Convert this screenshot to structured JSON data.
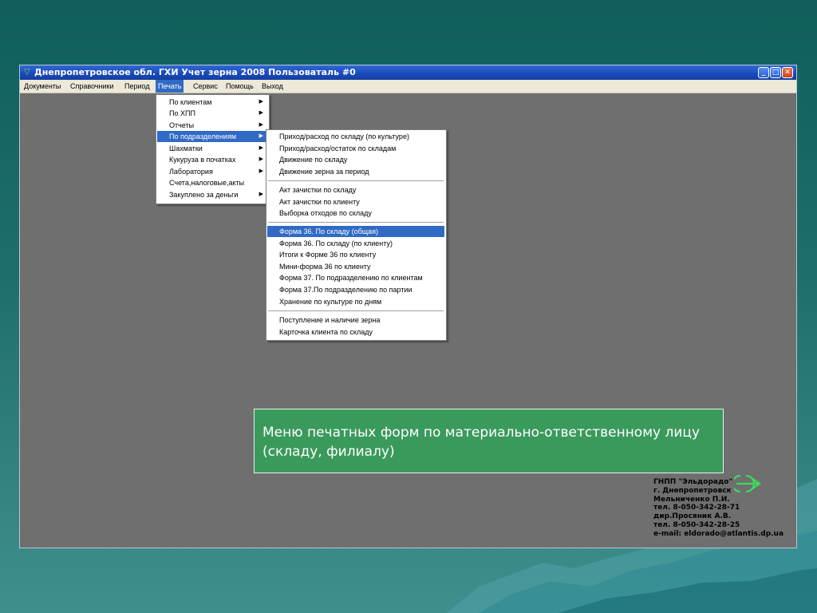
{
  "window": {
    "title": "Днепропетровское  обл. ГХИ Учет зерна 2008 Пользоваталь #0",
    "controls": [
      "minimize",
      "maximize",
      "close"
    ]
  },
  "menubar": {
    "items": [
      {
        "label": "Документы"
      },
      {
        "label": "Справочники"
      },
      {
        "label": "Период"
      },
      {
        "label": "Печать",
        "active": true
      },
      {
        "label": "Сервис"
      },
      {
        "label": "Помощь"
      },
      {
        "label": "Выход"
      }
    ]
  },
  "print_menu": {
    "items": [
      {
        "label": "По клиентам",
        "submenu": true
      },
      {
        "label": "По ХПП",
        "submenu": true
      },
      {
        "label": "Отчеты",
        "submenu": true
      },
      {
        "label": "По подразделениям",
        "submenu": true,
        "highlighted": true
      },
      {
        "label": "Шахматки",
        "submenu": true
      },
      {
        "label": "Кукуруза в початках",
        "submenu": true
      },
      {
        "label": "Лаборатория",
        "submenu": true
      },
      {
        "label": "Счета,налоговые,акты",
        "submenu": false
      },
      {
        "label": "Закуплено за деньги",
        "submenu": true
      }
    ]
  },
  "subdivision_menu": {
    "items": [
      {
        "label": "Приход/расход по складу (по культуре)"
      },
      {
        "label": "Приход/расход/остаток по складам"
      },
      {
        "label": "Движение по складу"
      },
      {
        "label": "Движение зерна за период"
      },
      {
        "label": "Акт зачистки по складу"
      },
      {
        "label": "Акт зачистки по клиенту"
      },
      {
        "label": "Выборка отходов по складу"
      },
      {
        "label": "Форма 36. По складу (общая)",
        "highlighted": true
      },
      {
        "label": "Форма 36. По складу (по клиенту)"
      },
      {
        "label": "Итоги к Форме 36 по клиенту"
      },
      {
        "label": "Мини-форма 36 по клиенту"
      },
      {
        "label": "Форма 37. По подразделению по клиентам"
      },
      {
        "label": "Форма 37.По подразделению по партии"
      },
      {
        "label": "Хранение по культуре по дням"
      },
      {
        "label": "Поступление и наличие зерна"
      },
      {
        "label": "Карточка клиента по складу"
      }
    ]
  },
  "caption": "Меню печатных форм по материально-ответственному лицу (складу, филиалу)",
  "contact": {
    "lines": [
      "ГНПП \"Эльдорадо\"",
      "г. Днепропетровск",
      "Мельниченко П.И.",
      "тел. 8-050-342-28-71",
      "дир.Просяник А.В.",
      "тел. 8-050-342-28-25",
      "e-mail: eldorado@atlantis.dp.ua"
    ]
  },
  "colors": {
    "title_bar": "#1948b8",
    "menu_highlight": "#316ac5",
    "workspace": "#6f6f6f",
    "caption_bg": "#3a9a5c",
    "logo": "#3ddc5a"
  }
}
